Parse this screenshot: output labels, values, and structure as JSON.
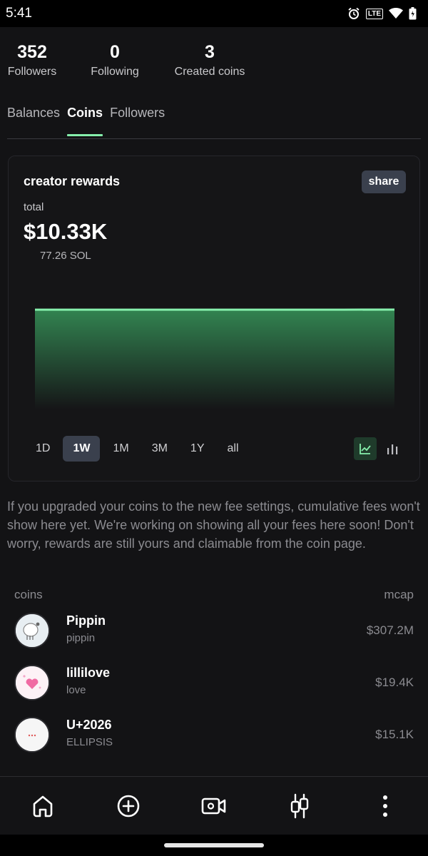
{
  "status": {
    "time": "5:41",
    "lte_label": "LTE",
    "icons": [
      "alarm-icon",
      "volte-icon",
      "wifi-icon",
      "battery-icon"
    ]
  },
  "stats": [
    {
      "value": "352",
      "label": "Followers"
    },
    {
      "value": "0",
      "label": "Following"
    },
    {
      "value": "3",
      "label": "Created coins"
    }
  ],
  "tabs": [
    {
      "label": "Balances",
      "active": false
    },
    {
      "label": "Coins",
      "active": true
    },
    {
      "label": "Followers",
      "active": false
    }
  ],
  "rewards": {
    "title": "creator rewards",
    "share_label": "share",
    "total_label": "total",
    "total_usd": "$10.33K",
    "total_sol": "77.26 SOL",
    "ranges": [
      "1D",
      "1W",
      "1M",
      "3M",
      "1Y",
      "all"
    ],
    "active_range": "1W",
    "chart_modes": [
      "line-chart-icon",
      "bar-chart-icon"
    ],
    "accent": "#86efac"
  },
  "chart_data": {
    "type": "area",
    "series": [
      {
        "values": [
          10.33,
          10.33,
          10.33,
          10.33,
          10.33,
          10.33,
          10.33,
          10.34
        ]
      }
    ]
  },
  "note": "If you upgraded your coins to the new fee settings, cumulative fees won't show here yet. We're working on showing all your fees here soon! Don't worry, rewards are still yours and claimable from the coin page.",
  "coins_table": {
    "header_left": "coins",
    "header_right": "mcap",
    "rows": [
      {
        "name": "Pippin",
        "ticker": "pippin",
        "mcap": "$307.2M"
      },
      {
        "name": "lillilove",
        "ticker": "love",
        "mcap": "$19.4K"
      },
      {
        "name": "U+2026",
        "ticker": "ELLIPSIS",
        "mcap": "$15.1K"
      }
    ]
  },
  "nav": [
    "home-icon",
    "create-icon",
    "video-icon",
    "trade-icon",
    "more-icon"
  ]
}
